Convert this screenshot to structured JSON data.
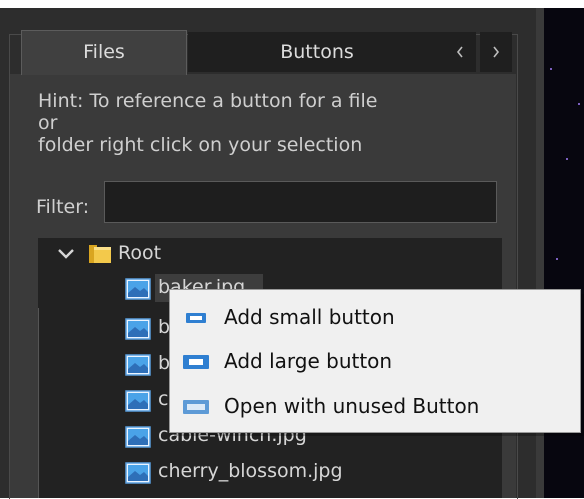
{
  "tabs": [
    {
      "label": "Files",
      "active": true
    },
    {
      "label": "Buttons",
      "active": false
    }
  ],
  "tab_nav": {
    "prev": "‹",
    "next": "›"
  },
  "hint": "Hint: To reference a button for a file\nor\nfolder right click on your selection",
  "filter": {
    "label": "Filter:",
    "value": ""
  },
  "tree": {
    "root": {
      "label": "Root",
      "expanded": true
    },
    "files": [
      {
        "label": "baker.jpg",
        "selected": true
      },
      {
        "label": "b"
      },
      {
        "label": "b"
      },
      {
        "label": "c"
      },
      {
        "label": "cable-winch.jpg"
      },
      {
        "label": "cherry_blossom.jpg"
      }
    ]
  },
  "context_menu": {
    "items": [
      {
        "label": "Add small button",
        "icon": "small-button-icon"
      },
      {
        "label": "Add large button",
        "icon": "large-button-icon"
      },
      {
        "label": "Open with unused Button",
        "icon": "unused-button-icon"
      }
    ]
  },
  "colors": {
    "panel": "#2d2d2d",
    "tree": "#222222",
    "menu": "#f0f0f0",
    "icon_blue": "#2f7fd1"
  }
}
